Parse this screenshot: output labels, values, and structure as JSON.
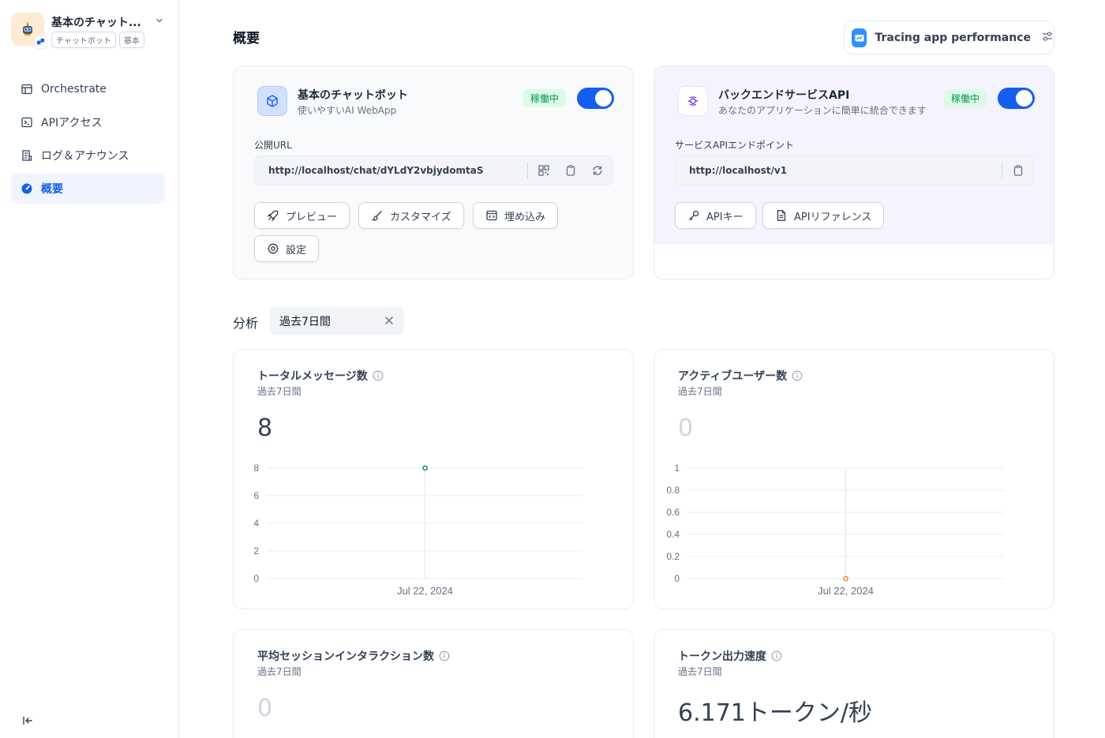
{
  "app": {
    "name": "基本のチャット...",
    "tags": [
      "チャットボット",
      "基本"
    ]
  },
  "nav": [
    {
      "label": "Orchestrate",
      "icon": "layout-icon",
      "active": false
    },
    {
      "label": "APIアクセス",
      "icon": "terminal-icon",
      "active": false
    },
    {
      "label": "ログ＆アナウンス",
      "icon": "file-list-icon",
      "active": false
    },
    {
      "label": "概要",
      "icon": "dashboard-icon",
      "active": true
    }
  ],
  "page": {
    "title": "概要"
  },
  "tracing": {
    "label": "Tracing app performance"
  },
  "webapp_card": {
    "title": "基本のチャットボット",
    "subtitle": "使いやすいAI WebApp",
    "status": "稼働中",
    "field_label": "公開URL",
    "url": "http://localhost/chat/dYLdY2vbjydomtaS",
    "buttons": [
      "プレビュー",
      "カスタマイズ",
      "埋め込み",
      "設定"
    ]
  },
  "api_card": {
    "title": "バックエンドサービスAPI",
    "subtitle": "あなたのアプリケーションに簡単に統合できます",
    "status": "稼働中",
    "field_label": "サービスAPIエンドポイント",
    "url": "http://localhost/v1",
    "buttons": [
      "APIキー",
      "APIリファレンス"
    ]
  },
  "analysis": {
    "label": "分析",
    "period": "過去7日間"
  },
  "metrics": [
    {
      "title": "トータルメッセージ数",
      "sub": "過去7日間",
      "value": "8"
    },
    {
      "title": "アクティブユーザー数",
      "sub": "過去7日間",
      "value": "0"
    },
    {
      "title": "平均セッションインタラクション数",
      "sub": "過去7日間",
      "value": "0"
    },
    {
      "title": "トークン出力速度",
      "sub": "過去7日間",
      "value": "6.171トークン/秒"
    }
  ],
  "chart_data": [
    {
      "type": "line",
      "title": "トータルメッセージ数",
      "x": [
        "Jul 22, 2024"
      ],
      "series": [
        {
          "values": [
            8
          ]
        }
      ],
      "yticks": [
        "8",
        "6",
        "4",
        "2",
        "0"
      ],
      "ylim": [
        0,
        8
      ],
      "grid": true,
      "color": "#0e9384"
    },
    {
      "type": "line",
      "title": "アクティブユーザー数",
      "x": [
        "Jul 22, 2024"
      ],
      "series": [
        {
          "values": [
            0
          ]
        }
      ],
      "yticks": [
        "1",
        "0.8",
        "0.6",
        "0.4",
        "0.2",
        "0"
      ],
      "ylim": [
        0,
        1
      ],
      "grid": true,
      "color": "#f38744"
    }
  ]
}
